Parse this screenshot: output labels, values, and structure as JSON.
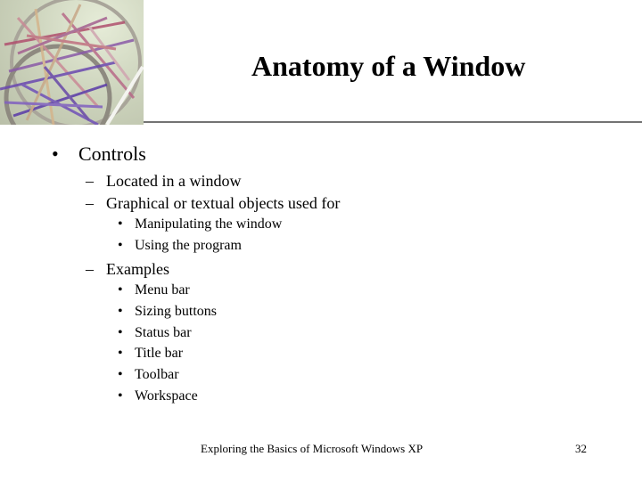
{
  "slide": {
    "title": "Anatomy of a Window",
    "image": "woven-sphere-photo",
    "bullets": {
      "main": {
        "marker": "•",
        "text": "Controls"
      },
      "sub": [
        {
          "marker": "–",
          "text": "Located in a window"
        },
        {
          "marker": "–",
          "text": "Graphical or textual objects used for"
        }
      ],
      "uses": [
        {
          "marker": "•",
          "text": "Manipulating the window"
        },
        {
          "marker": "•",
          "text": "Using the program"
        }
      ],
      "examples_heading": {
        "marker": "–",
        "text": "Examples"
      },
      "examples": [
        {
          "marker": "•",
          "text": "Menu bar"
        },
        {
          "marker": "•",
          "text": "Sizing buttons"
        },
        {
          "marker": "•",
          "text": "Status bar"
        },
        {
          "marker": "•",
          "text": "Title bar"
        },
        {
          "marker": "•",
          "text": "Toolbar"
        },
        {
          "marker": "•",
          "text": "Workspace"
        }
      ]
    },
    "footer": {
      "text": "Exploring the Basics of Microsoft Windows XP",
      "page_number": "32"
    }
  }
}
